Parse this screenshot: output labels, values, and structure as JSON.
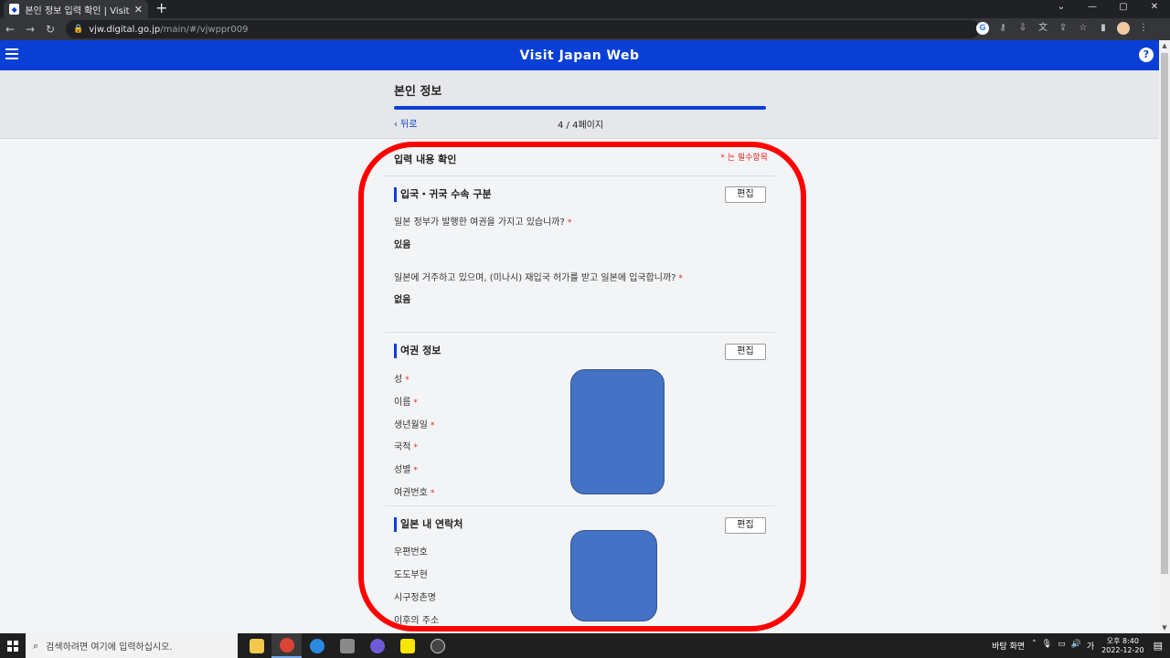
{
  "browser": {
    "tab_title": "본인 정보 입력 확인 | Visit Japan Web",
    "tab_close": "✕",
    "new_tab": "+",
    "url_host": "vjw.digital.go.jp",
    "url_path": "/main/#/vjwppr009",
    "min": "⌄",
    "minimize": "—",
    "maximize": "▢",
    "close": "✕",
    "back": "←",
    "forward": "→",
    "reload": "↻"
  },
  "site": {
    "title": "Visit Japan Web",
    "help": "?"
  },
  "page": {
    "title": "본인 정보",
    "back": "‹ 뒤로",
    "count": "4 / 4페이지",
    "progress": 1.0
  },
  "content": {
    "confirm_title": "입력 내용 확인",
    "required_note": "* 는 필수항목",
    "edit_label": "편집",
    "req_mark": "*",
    "section1": {
      "title": "입국・귀국 수속 구분",
      "q1": "일본 정부가 발행한 여권을 가지고 있습니까?",
      "a1": "있음",
      "q2": "일본에 거주하고 있으며, (미나시) 재입국 허가를 받고 일본에 입국합니까?",
      "a2": "없음"
    },
    "section2": {
      "title": "여권 정보",
      "labels": [
        "성",
        "이름",
        "생년월일",
        "국적",
        "성별",
        "여권번호"
      ]
    },
    "section3": {
      "title": "일본 내 연락처",
      "labels": [
        "우편번호",
        "도도부현",
        "시구정촌명",
        "이후의 주소"
      ]
    }
  },
  "taskbar": {
    "search_placeholder": "검색하려면 여기에 입력하십시오.",
    "desktop_label": "바탕 화면",
    "time": "오후 8:40",
    "date": "2022-12-20"
  },
  "colors": {
    "brand_blue": "#0a3fd6",
    "required_red": "#e3261f",
    "highlight_red": "#ff0000",
    "redaction_blue": "#4472c4"
  }
}
